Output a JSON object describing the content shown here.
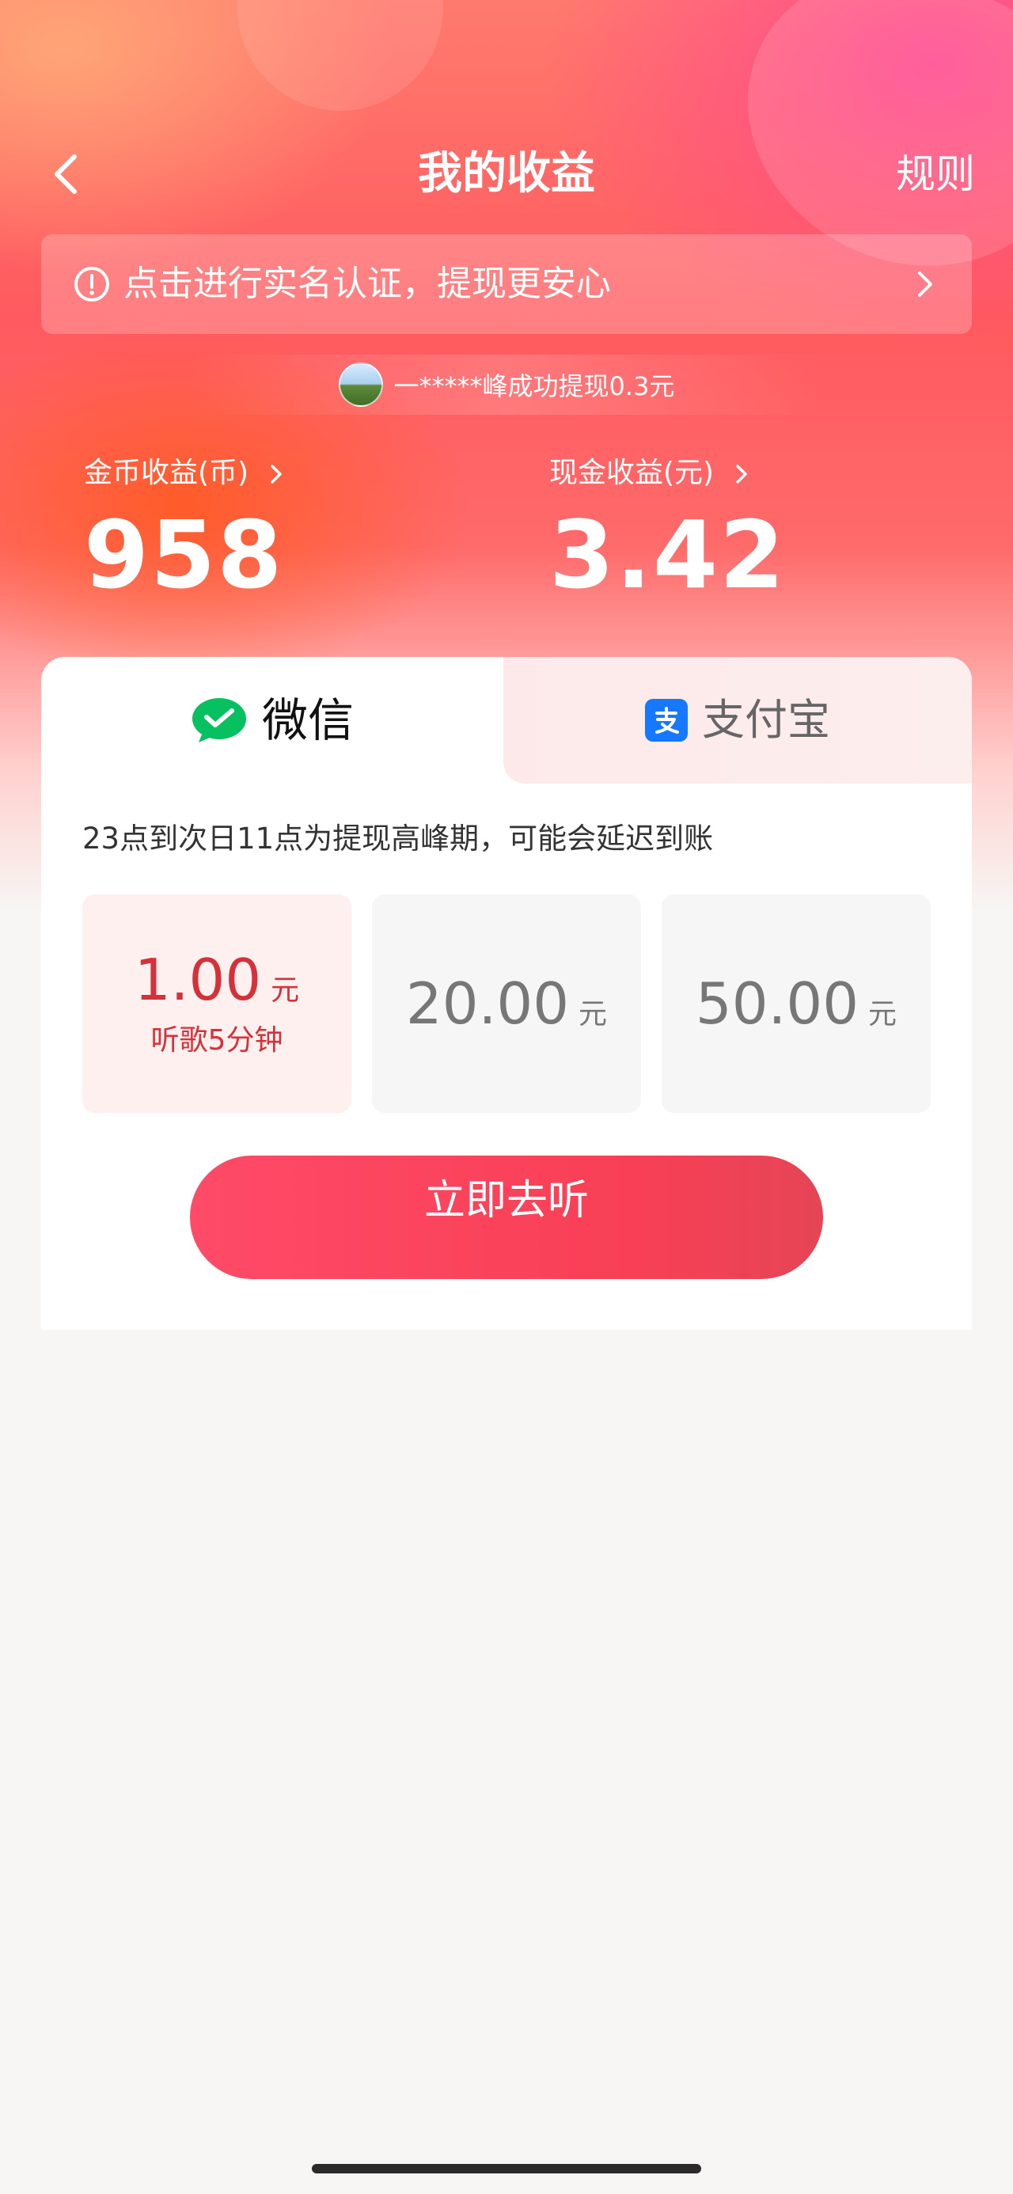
{
  "header": {
    "title": "我的收益",
    "rules_label": "规则"
  },
  "notice": {
    "text": "点击进行实名认证，提现更安心"
  },
  "ticker": {
    "text": "一*****峰成功提现0.3元"
  },
  "stats": {
    "coins_label": "金币收益(币)",
    "coins_value": "958",
    "cash_label": "现金收益(元)",
    "cash_value": "3.42"
  },
  "tabs": [
    {
      "label": "微信",
      "icon": "wechat-icon",
      "active": true
    },
    {
      "label": "支付宝",
      "icon": "alipay-icon",
      "active": false
    }
  ],
  "peak_note": "23点到次日11点为提现高峰期，可能会延迟到账",
  "options": [
    {
      "amount": "1.00",
      "unit": "元",
      "sub": "听歌5分钟",
      "selected": true
    },
    {
      "amount": "20.00",
      "unit": "元",
      "selected": false
    },
    {
      "amount": "50.00",
      "unit": "元",
      "selected": false
    }
  ],
  "cta": {
    "label": "立即去听"
  },
  "colors": {
    "accent": "#d3323a",
    "button": "#f83f55",
    "wechat": "#07c160",
    "alipay": "#1677ff"
  }
}
